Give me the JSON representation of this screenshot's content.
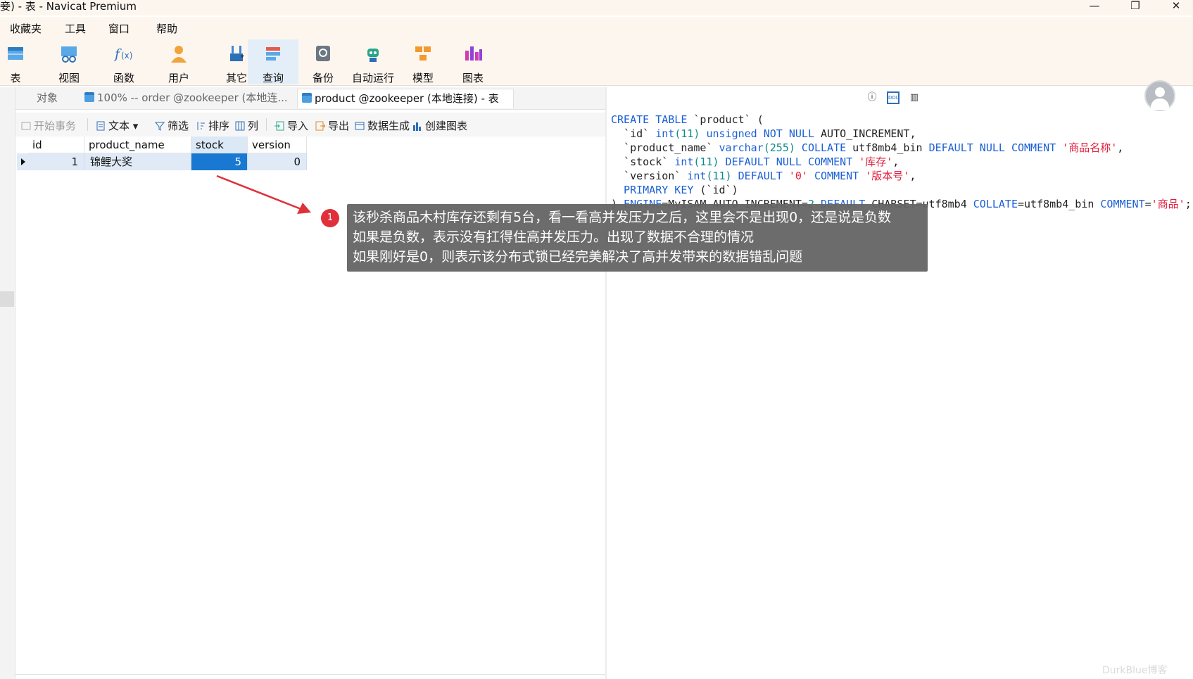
{
  "window": {
    "title": "妾) - 表 - Navicat Premium",
    "controls": [
      "—",
      "❐",
      "✕"
    ]
  },
  "menu": [
    "收藏夹",
    "工具",
    "窗口",
    "帮助"
  ],
  "ribbon": {
    "items": [
      {
        "label": "表",
        "icon": "table-icon"
      },
      {
        "label": "视图",
        "icon": "view-icon"
      },
      {
        "label": "函数",
        "icon": "function-icon"
      },
      {
        "label": "用户",
        "icon": "user-icon"
      },
      {
        "label": "其它",
        "icon": "tools-icon"
      },
      {
        "label": "查询",
        "icon": "query-icon"
      },
      {
        "label": "备份",
        "icon": "backup-icon"
      },
      {
        "label": "自动运行",
        "icon": "robot-icon"
      },
      {
        "label": "模型",
        "icon": "model-icon"
      },
      {
        "label": "图表",
        "icon": "chart-icon"
      }
    ],
    "active": "查询"
  },
  "tabs": [
    {
      "label": "对象"
    },
    {
      "label": "100% -- order @zookeeper (本地连..."
    },
    {
      "label": "product @zookeeper (本地连接) - 表"
    }
  ],
  "grid_toolbar": {
    "begin_tx": "开始事务",
    "text": "文本",
    "filter": "筛选",
    "sort": "排序",
    "columns": "列",
    "import": "导入",
    "export": "导出",
    "generate": "数据生成",
    "create_chart": "创建图表"
  },
  "table": {
    "columns": [
      "id",
      "product_name",
      "stock",
      "version"
    ],
    "rows": [
      {
        "id": "1",
        "product_name": "锦鲤大奖",
        "stock": "5",
        "version": "0"
      }
    ]
  },
  "ddl": {
    "l1_kw": "CREATE TABLE",
    "l1_rest": " `product` (",
    "l2_a": "  `id` ",
    "l2_type": "int",
    "l2_num": "(11)",
    "l2_kw": " unsigned NOT NULL",
    "l2_rest": " AUTO_INCREMENT,",
    "l3_a": "  `product_name` ",
    "l3_type": "varchar",
    "l3_num": "(255)",
    "l3_kw": " COLLATE",
    "l3_mid": " utf8mb4_bin ",
    "l3_kw2": "DEFAULT NULL COMMENT",
    "l3_str": " '商品名称'",
    "l3_end": ",",
    "l4_a": "  `stock` ",
    "l4_type": "int",
    "l4_num": "(11)",
    "l4_kw": " DEFAULT NULL COMMENT",
    "l4_str": " '库存'",
    "l4_end": ",",
    "l5_a": "  `version` ",
    "l5_type": "int",
    "l5_num": "(11)",
    "l5_kw": " DEFAULT",
    "l5_str": " '0'",
    "l5_kw2": " COMMENT",
    "l5_str2": " '版本号'",
    "l5_end": ",",
    "l6_kw": "  PRIMARY KEY",
    "l6_rest": " (`id`)",
    "l7_a": ") ",
    "l7_kw": "ENGINE",
    "l7_b": "=MyISAM AUTO_INCREMENT=",
    "l7_num": "2",
    "l7_kw2": " DEFAULT",
    "l7_c": " CHARSET=utf8mb4 ",
    "l7_kw3": "COLLATE",
    "l7_d": "=utf8mb4_bin ",
    "l7_kw4": "COMMENT",
    "l7_e": "=",
    "l7_str": "'商品'",
    "l7_end": ";"
  },
  "annotation": {
    "badge": "1",
    "lines": [
      "该秒杀商品木村库存还剩有5台，看一看高并发压力之后，这里会不是出现0，还是说是负数",
      "如果是负数，表示没有扛得住高并发压力。出现了数据不合理的情况",
      "如果刚好是0，则表示该分布式锁已经完美解决了高并发带来的数据错乱问题"
    ]
  },
  "watermark": "DurkBlue博客"
}
